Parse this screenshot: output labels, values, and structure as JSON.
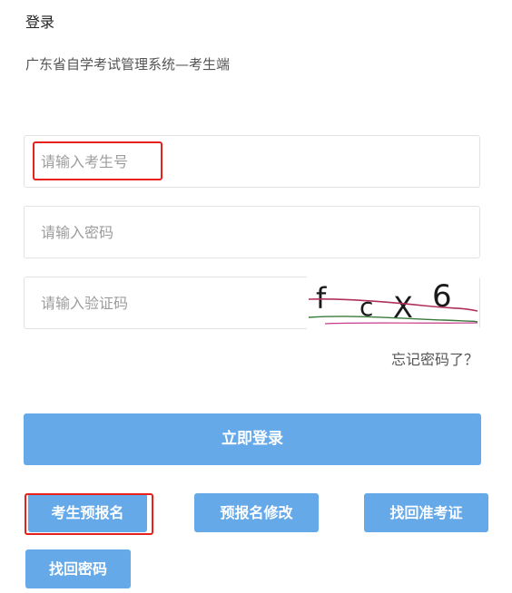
{
  "header": {
    "title": "登录",
    "subtitle": "广东省自学考试管理系统—考生端"
  },
  "form": {
    "candidate_id_placeholder": "请输入考生号",
    "password_placeholder": "请输入密码",
    "captcha_placeholder": "请输入验证码",
    "captcha_text": "fcX6",
    "forgot_password": "忘记密码了？",
    "login_button": "立即登录"
  },
  "actions": {
    "pre_register": "考生预报名",
    "modify_pre_register": "预报名修改",
    "find_admission_ticket": "找回准考证",
    "find_password": "找回密码"
  },
  "colors": {
    "primary_button": "#66a9e9",
    "highlight_border": "#e8201b"
  }
}
